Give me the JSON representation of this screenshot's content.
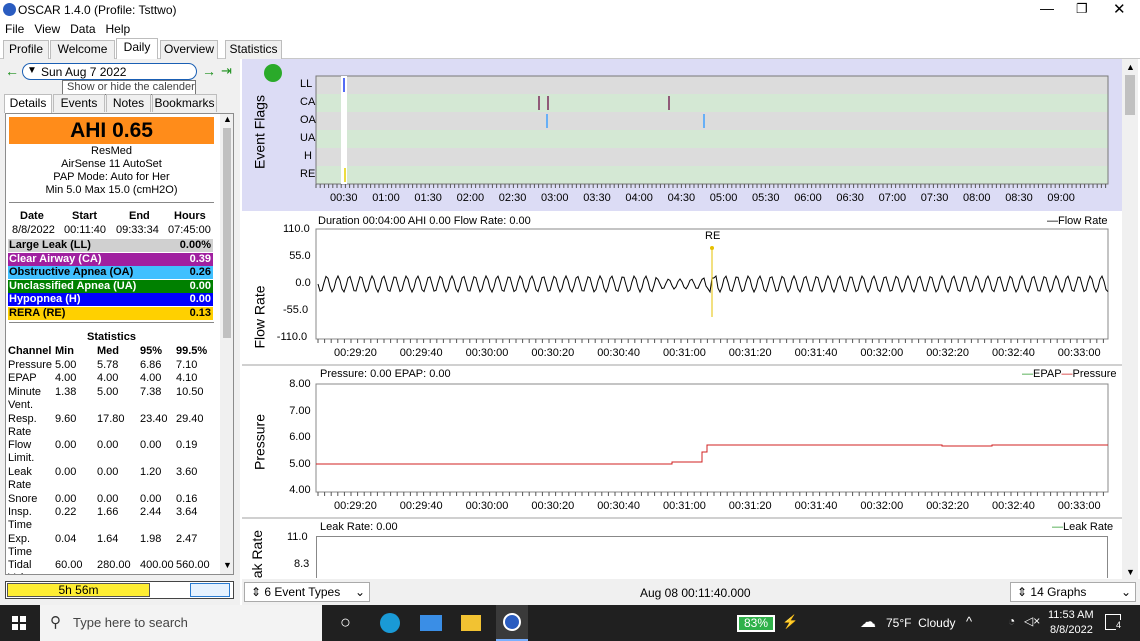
{
  "window": {
    "title": "OSCAR 1.4.0 (Profile: Tsttwo)"
  },
  "menu": [
    "File",
    "View",
    "Data",
    "Help"
  ],
  "tabs": [
    "Profile",
    "Welcome",
    "Daily",
    "Overview",
    "Statistics"
  ],
  "date": {
    "value": "Sun Aug 7 2022",
    "tooltip": "Show or hide the calender"
  },
  "left_tabs": [
    "Details",
    "Events",
    "Notes",
    "Bookmarks"
  ],
  "summary": {
    "ahi": "AHI 0.65",
    "machine": "ResMed",
    "model": "AirSense 11 AutoSet",
    "mode": "PAP Mode: Auto for Her",
    "pressure": "Min 5.0 Max 15.0 (cmH2O)"
  },
  "session": {
    "headers": [
      "Date",
      "Start",
      "End",
      "Hours"
    ],
    "values": [
      "8/8/2022",
      "00:11:40",
      "09:33:34",
      "07:45:00"
    ]
  },
  "events": [
    {
      "name": "Large Leak (LL)",
      "value": "0.00%",
      "color": "#d0d0d0",
      "text": "#000"
    },
    {
      "name": "Clear Airway (CA)",
      "value": "0.39",
      "color": "#a020a0",
      "text": "#fff"
    },
    {
      "name": "Obstructive Apnea (OA)",
      "value": "0.26",
      "color": "#40c0ff",
      "text": "#000"
    },
    {
      "name": "Unclassified Apnea (UA)",
      "value": "0.00",
      "color": "#008000",
      "text": "#fff"
    },
    {
      "name": "Hypopnea (H)",
      "value": "0.00",
      "color": "#0000ff",
      "text": "#fff"
    },
    {
      "name": "RERA (RE)",
      "value": "0.13",
      "color": "#ffd000",
      "text": "#000"
    }
  ],
  "stats": {
    "title": "Statistics",
    "headers": [
      "Channel",
      "Min",
      "Med",
      "95%",
      "99.5%"
    ],
    "rows": [
      [
        "Pressure",
        "5.00",
        "5.78",
        "6.86",
        "7.10"
      ],
      [
        "EPAP",
        "4.00",
        "4.00",
        "4.00",
        "4.10"
      ],
      [
        "Minute Vent.",
        "1.38",
        "5.00",
        "7.38",
        "10.50"
      ],
      [
        "Resp. Rate",
        "9.60",
        "17.80",
        "23.40",
        "29.40"
      ],
      [
        "Flow Limit.",
        "0.00",
        "0.00",
        "0.00",
        "0.19"
      ],
      [
        "Leak Rate",
        "0.00",
        "0.00",
        "1.20",
        "3.60"
      ],
      [
        "Snore",
        "0.00",
        "0.00",
        "0.00",
        "0.16"
      ],
      [
        "Insp. Time",
        "0.22",
        "1.66",
        "2.44",
        "3.64"
      ],
      [
        "Exp. Time",
        "0.04",
        "1.64",
        "1.98",
        "2.47"
      ],
      [
        "Tidal Volume",
        "60.00",
        "280.00",
        "400.00",
        "560.00"
      ]
    ]
  },
  "progress": {
    "label": "5h 56m"
  },
  "event_flags": {
    "title": "Event Flags",
    "rows": [
      "LL",
      "CA",
      "OA",
      "UA",
      "H",
      "RE"
    ],
    "times": [
      "00:30",
      "01:00",
      "01:30",
      "02:00",
      "02:30",
      "03:00",
      "03:30",
      "04:00",
      "04:30",
      "05:00",
      "05:30",
      "06:00",
      "06:30",
      "07:00",
      "07:30",
      "08:00",
      "08:30",
      "09:00"
    ]
  },
  "flow": {
    "axis": "Flow Rate",
    "header": "Duration 00:04:00 AHI 0.00 Flow Rate: 0.00",
    "legend": "Flow Rate",
    "yticks": [
      "110.0",
      "55.0",
      "0.0",
      "-55.0",
      "-110.0"
    ],
    "marker": "RE"
  },
  "pressure": {
    "axis": "Pressure",
    "header": "Pressure: 0.00 EPAP: 0.00",
    "legend_epap": "EPAP",
    "legend_pressure": "Pressure",
    "yticks": [
      "8.00",
      "7.00",
      "6.00",
      "5.00",
      "4.00"
    ]
  },
  "leak": {
    "axis": "Leak Rate",
    "header": "Leak Rate: 0.00",
    "legend": "Leak Rate",
    "yticks": [
      "11.0",
      "8.3"
    ]
  },
  "xticks": [
    "00:29:20",
    "00:29:40",
    "00:30:00",
    "00:30:20",
    "00:30:40",
    "00:31:00",
    "00:31:20",
    "00:31:40",
    "00:32:00",
    "00:32:20",
    "00:32:40",
    "00:33:00"
  ],
  "bottom": {
    "event_types": "6 Event Types",
    "time": "Aug 08 00:11:40.000",
    "graphs": "14 Graphs"
  },
  "taskbar": {
    "search": "Type here to search",
    "battery": "83%",
    "weather": "75°F  Cloudy",
    "time": "11:53 AM",
    "date": "8/8/2022",
    "notif": "4"
  }
}
